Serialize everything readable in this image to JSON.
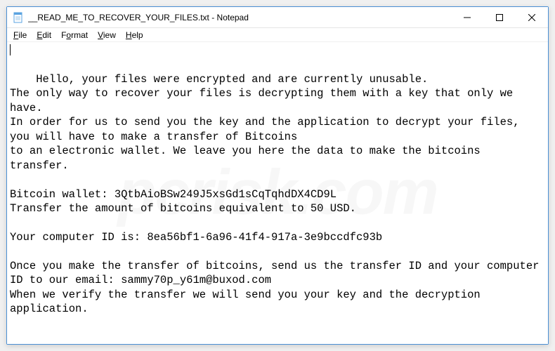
{
  "titlebar": {
    "title": "__READ_ME_TO_RECOVER_YOUR_FILES.txt - Notepad"
  },
  "menu": {
    "file": "File",
    "edit": "Edit",
    "format": "Format",
    "view": "View",
    "help": "Help"
  },
  "content": {
    "text": "Hello, your files were encrypted and are currently unusable.\nThe only way to recover your files is decrypting them with a key that only we have.\nIn order for us to send you the key and the application to decrypt your files, you will have to make a transfer of Bitcoins\nto an electronic wallet. We leave you here the data to make the bitcoins transfer.\n\nBitcoin wallet: 3QtbAioBSw249J5xsGd1sCqTqhdDX4CD9L\nTransfer the amount of bitcoins equivalent to 50 USD.\n\nYour computer ID is: 8ea56bf1-6a96-41f4-917a-3e9bccdfc93b\n\nOnce you make the transfer of bitcoins, send us the transfer ID and your computer ID to our email: sammy70p_y61m@buxod.com\nWhen we verify the transfer we will send you your key and the decryption application."
  },
  "watermark": "pcrisk.com"
}
